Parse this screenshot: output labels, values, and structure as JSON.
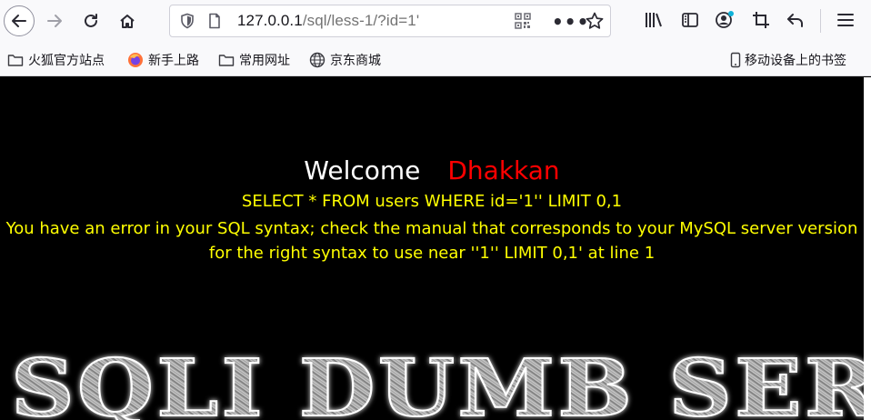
{
  "browser": {
    "url_host": "127.0.0.1",
    "url_path": "/sql/less-1/?id=1'",
    "more_label": "•••"
  },
  "bookmarks": [
    {
      "label": "火狐官方站点",
      "icon": "folder-icon"
    },
    {
      "label": "新手上路",
      "icon": "firefox-icon"
    },
    {
      "label": "常用网址",
      "icon": "folder-icon"
    },
    {
      "label": "京东商城",
      "icon": "globe-icon"
    }
  ],
  "mobile_bookmarks": "移动设备上的书签",
  "page": {
    "welcome": "Welcome",
    "name": "Dhakkan",
    "query": "SELECT * FROM users WHERE id='1'' LIMIT 0,1",
    "error": "You have an error in your SQL syntax; check the manual that corresponds to your MySQL server version for the right syntax to use near ''1'' LIMIT 0,1' at line 1",
    "banner_text": "SQLI DUMB SERI"
  },
  "colors": {
    "welcome": "#ffffff",
    "name": "#ff0000",
    "message": "#ffff00",
    "background": "#000000"
  }
}
